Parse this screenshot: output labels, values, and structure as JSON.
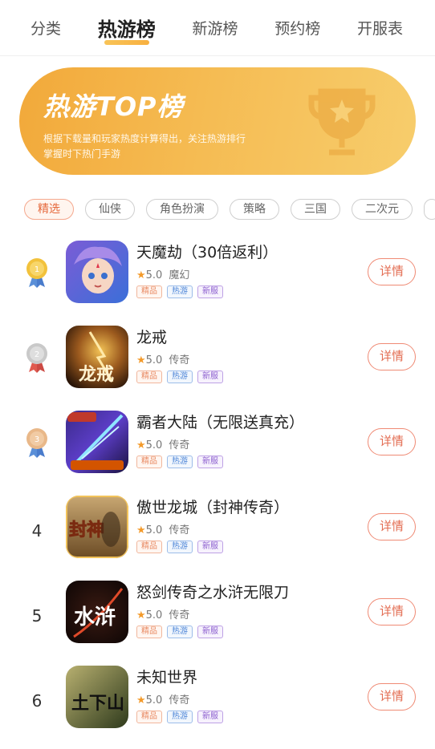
{
  "tabs": [
    {
      "label": "分类",
      "active": false
    },
    {
      "label": "热游榜",
      "active": true
    },
    {
      "label": "新游榜",
      "active": false
    },
    {
      "label": "预约榜",
      "active": false
    },
    {
      "label": "开服表",
      "active": false
    }
  ],
  "banner": {
    "title": "热游TOP榜",
    "desc": "根据下载量和玩家热度计算得出，关注热游排行掌握时下热门手游",
    "icon": "trophy-icon"
  },
  "chips": [
    "精选",
    "仙侠",
    "角色扮演",
    "策略",
    "三国",
    "二次元"
  ],
  "colors": {
    "accent": "#f5b03f",
    "detail_button": "#e36d52",
    "gold_medal": "#f2c23c",
    "silver_medal": "#c9c9c9",
    "bronze_medal": "#e9b889"
  },
  "detail_label": "详情",
  "games": [
    {
      "rank": "1",
      "medal": "gold",
      "name": "天魔劫（30倍返利）",
      "score": "5.0",
      "genre": "魔幻",
      "tags": [
        "精品",
        "热游",
        "新服"
      ]
    },
    {
      "rank": "2",
      "medal": "silver",
      "name": "龙戒",
      "score": "5.0",
      "genre": "传奇",
      "tags": [
        "精品",
        "热游",
        "新服"
      ],
      "icon_text": "龙戒"
    },
    {
      "rank": "3",
      "medal": "bronze",
      "name": "霸者大陆（无限送真充）",
      "score": "5.0",
      "genre": "传奇",
      "tags": [
        "精品",
        "热游",
        "新服"
      ]
    },
    {
      "rank": "4",
      "medal": "",
      "name": "傲世龙城（封神传奇）",
      "score": "5.0",
      "genre": "传奇",
      "tags": [
        "精品",
        "热游",
        "新服"
      ],
      "icon_text": "封神"
    },
    {
      "rank": "5",
      "medal": "",
      "name": "怒剑传奇之水浒无限刀",
      "score": "5.0",
      "genre": "传奇",
      "tags": [
        "精品",
        "热游",
        "新服"
      ],
      "icon_text": "水浒"
    },
    {
      "rank": "6",
      "medal": "",
      "name": "未知世界",
      "score": "5.0",
      "genre": "传奇",
      "tags": [
        "精品",
        "热游",
        "新服"
      ],
      "icon_text": "土下山"
    }
  ]
}
